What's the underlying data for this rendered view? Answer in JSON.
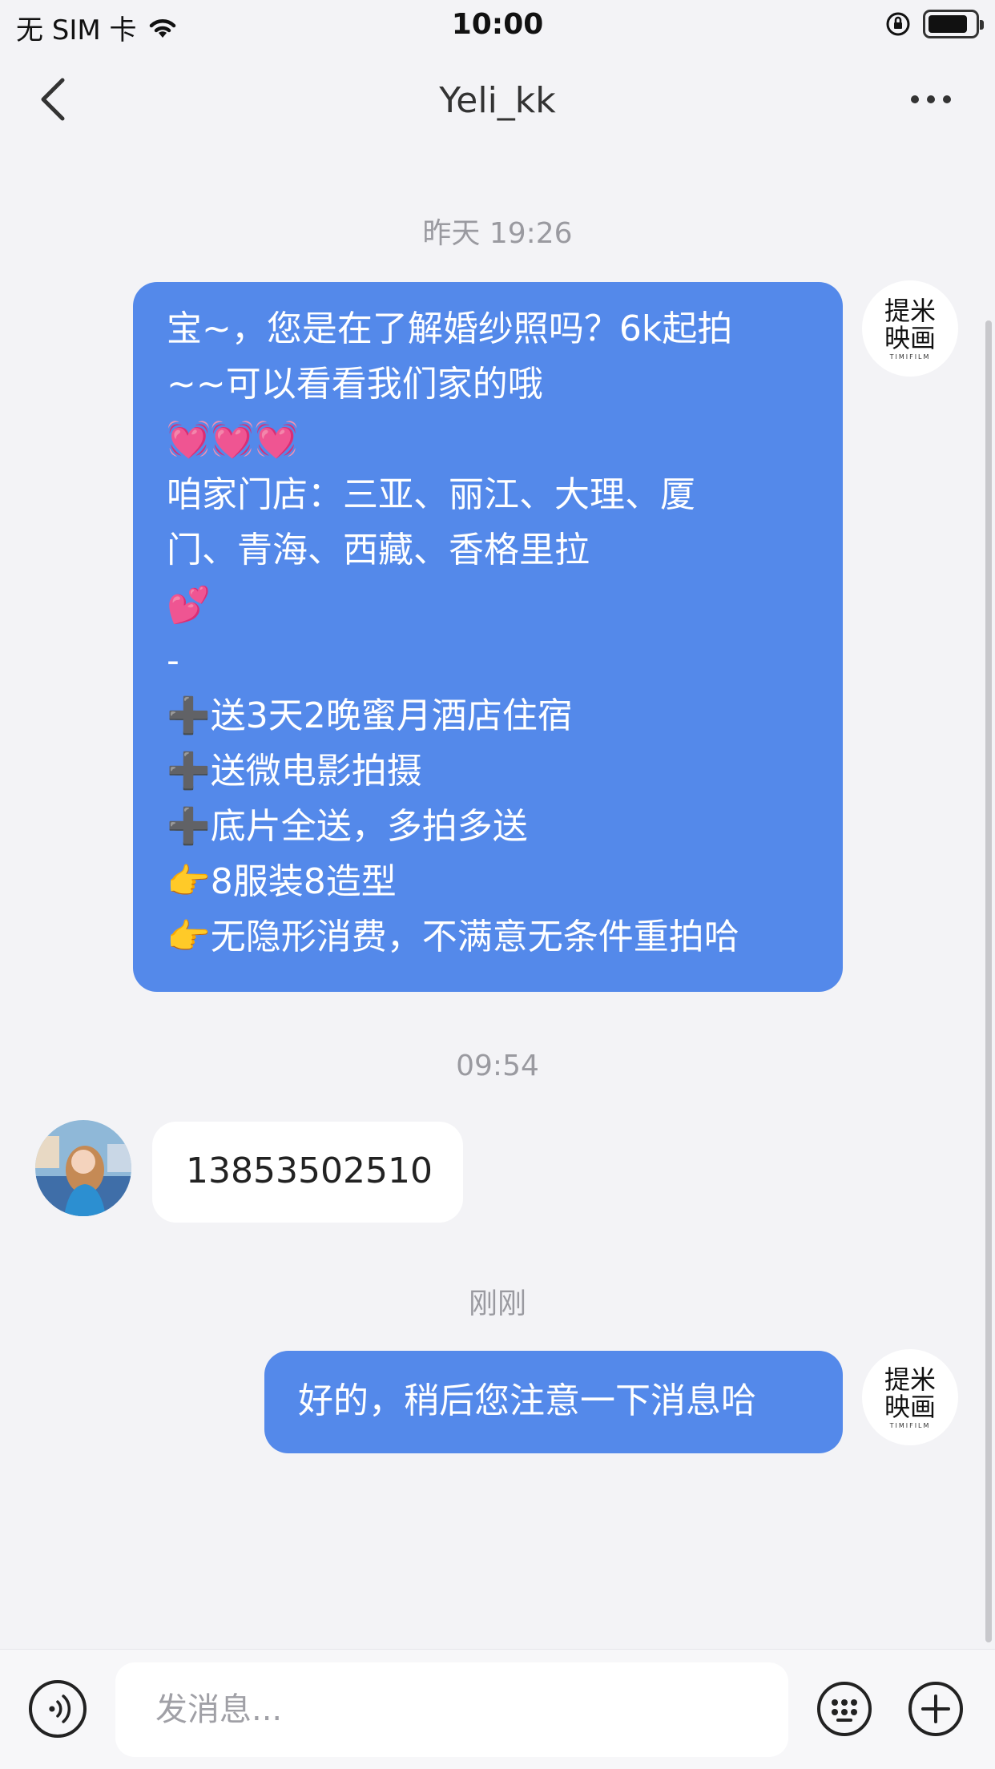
{
  "status_bar": {
    "carrier": "无 SIM 卡",
    "time": "10:00"
  },
  "nav": {
    "title": "Yeli_kk",
    "back_icon": "chevron-left-icon",
    "more_icon": "more-dots-icon"
  },
  "messages": [
    {
      "timestamp": "昨天 19:26",
      "direction": "outgoing",
      "avatar_text": "提米映画",
      "avatar_sub": "TIMIFILM",
      "lines": [
        "宝~，您是在了解婚纱照吗？6k起拍",
        "~~可以看看我们家的哦",
        "💓💓💓",
        "咱家门店：三亚、丽江、大理、厦",
        "门、青海、西藏、香格里拉",
        "💕",
        "-",
        "➕送3天2晚蜜月酒店住宿",
        "➕送微电影拍摄",
        "➕底片全送，多拍多送",
        "👉8服装8造型",
        "👉无隐形消费，不满意无条件重拍哈"
      ]
    },
    {
      "timestamp": "09:54",
      "direction": "incoming",
      "text": "13853502510"
    },
    {
      "timestamp": "刚刚",
      "direction": "outgoing",
      "avatar_text": "提米映画",
      "avatar_sub": "TIMIFILM",
      "text": "好的，稍后您注意一下消息哈"
    }
  ],
  "input_bar": {
    "placeholder": "发消息...",
    "voice_icon": "voice-icon",
    "emoji_icon": "emoji-icon",
    "plus_icon": "plus-icon"
  },
  "colors": {
    "outgoing_bubble": "#5489ea",
    "incoming_bubble": "#ffffff",
    "background": "#f3f3f6"
  }
}
